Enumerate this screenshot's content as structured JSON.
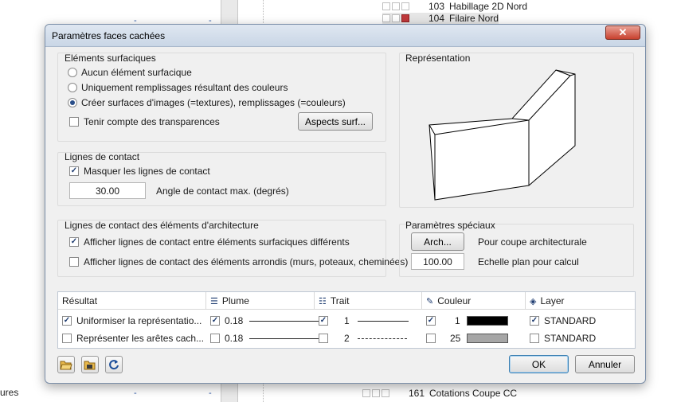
{
  "background": {
    "rows": [
      {
        "num": "103",
        "label": "Habillage 2D Nord"
      },
      {
        "num": "104",
        "label": "Filaire Nord"
      },
      {
        "num": "161",
        "label": "Cotations Coupe CC"
      }
    ],
    "left_text": "ures",
    "dash": "-"
  },
  "dialog": {
    "title": "Paramètres faces cachées",
    "close_glyph": "✕",
    "surface": {
      "label": "Eléments surfaciques",
      "options": [
        {
          "label": "Aucun élément surfacique",
          "selected": false
        },
        {
          "label": "Uniquement remplissages résultant des couleurs",
          "selected": false
        },
        {
          "label": "Créer surfaces d'images (=textures), remplissages (=couleurs)",
          "selected": true
        }
      ],
      "transparency_label": "Tenir compte des transparences",
      "transparency_checked": false,
      "aspects_button": "Aspects surf..."
    },
    "representation": {
      "label": "Représentation"
    },
    "contact": {
      "label": "Lignes de contact",
      "mask_label": "Masquer les lignes de contact",
      "mask_checked": true,
      "angle_value": "30.00",
      "angle_label": "Angle de contact max. (degrés)"
    },
    "arch_contact": {
      "label": "Lignes de contact des éléments d'architecture",
      "show_diff_label": "Afficher lignes de contact entre éléments surfaciques différents",
      "show_diff_checked": true,
      "show_round_label": "Afficher lignes de contact des éléments arrondis (murs, poteaux, cheminées)",
      "show_round_checked": false
    },
    "special": {
      "label": "Paramètres spéciaux",
      "arch_button": "Arch...",
      "arch_label": "Pour coupe architecturale",
      "scale_value": "100.00",
      "scale_label": "Echelle plan pour calcul"
    },
    "table": {
      "headers": [
        "Résultat",
        "Plume",
        "Trait",
        "Couleur",
        "Layer"
      ],
      "rows": [
        {
          "label": "Uniformiser la représentatio...",
          "checked": true,
          "pen_checked": true,
          "pen": "0.18",
          "line_checked": true,
          "line": "1",
          "color_checked": true,
          "color": "1",
          "color_hex": "#000000",
          "layer_checked": true,
          "layer": "STANDARD"
        },
        {
          "label": "Représenter les arêtes cach...",
          "checked": false,
          "pen_checked": false,
          "pen": "0.18",
          "line_checked": false,
          "line": "2",
          "color_checked": false,
          "color": "25",
          "color_hex": "#a6a6a6",
          "layer_checked": false,
          "layer": "STANDARD"
        }
      ]
    },
    "ok_button": "OK",
    "cancel_button": "Annuler",
    "check_glyph": "✓"
  }
}
